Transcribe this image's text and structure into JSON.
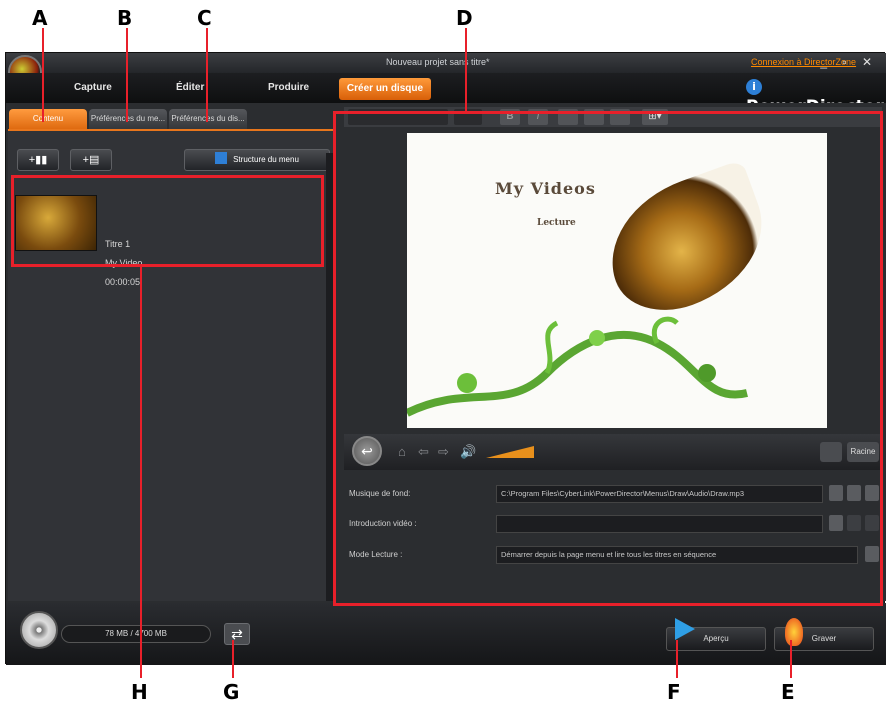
{
  "callouts": {
    "A": "A",
    "B": "B",
    "C": "C",
    "D": "D",
    "E": "E",
    "F": "F",
    "G": "G",
    "H": "H"
  },
  "window": {
    "title": "Nouveau projet sans titre*",
    "connect_link": "Connexion à DirectorZone",
    "controls": "_ ▫ ✕"
  },
  "nav": {
    "items": [
      "Capture",
      "Éditer",
      "Produire"
    ],
    "active": "Créer un disque",
    "brand": "PowerDirector",
    "brand_icon": "i"
  },
  "tabs": [
    "Contenu",
    "Préférences du me...",
    "Préférences du dis..."
  ],
  "toolbar": {
    "add_video": "+▮▮",
    "add_list": "+▤",
    "structure": "Structure du menu"
  },
  "content_item": {
    "title": "Titre 1",
    "name": "My Video",
    "duration": "00:00:05"
  },
  "preview": {
    "title": "My Videos",
    "lecture": "Lecture"
  },
  "format_bar": {
    "bold": "B",
    "italic": "I",
    "layout": "⊞▾"
  },
  "controls": {
    "play": "↩",
    "home": "⌂",
    "prev": "⇦",
    "next": "⇨",
    "volume": "🔊",
    "root": "Racine"
  },
  "properties": {
    "music_label": "Musique de fond:",
    "music_value": "C:\\Program Files\\CyberLink\\PowerDirector\\Menus\\Draw\\Audio\\Draw.mp3",
    "intro_label": "Introduction vidéo :",
    "intro_value": "",
    "mode_label": "Mode Lecture :",
    "mode_value": "Démarrer depuis la page menu et lire tous les titres en séquence"
  },
  "bottom": {
    "capacity": "78 MB / 4700 MB",
    "swap": "⇄",
    "preview_btn": "Aperçu",
    "burn_btn": "Graver"
  },
  "colors": {
    "accent": "#e8761c",
    "callout": "#e8202a"
  }
}
